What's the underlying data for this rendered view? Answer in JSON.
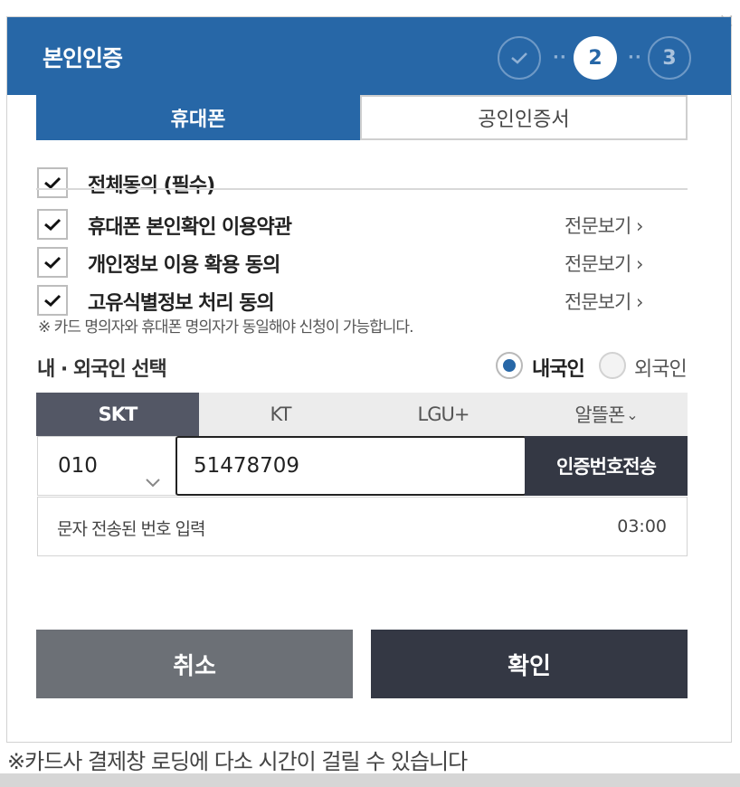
{
  "header": {
    "title": "본인인증",
    "steps": [
      {
        "label": "",
        "state": "done",
        "icon": "check-icon"
      },
      {
        "label": "2",
        "state": "active"
      },
      {
        "label": "3",
        "state": "pending"
      }
    ],
    "step_separator": "··"
  },
  "tabs": [
    {
      "label": "휴대폰",
      "active": true
    },
    {
      "label": "공인인증서",
      "active": false
    }
  ],
  "agreements": {
    "all": {
      "label": "전체동의 (필수)",
      "checked": true
    },
    "items": [
      {
        "label": "휴대폰 본인확인 이용약관",
        "checked": true,
        "link": "전문보기"
      },
      {
        "label": "개인정보 이용 확용 동의",
        "checked": true,
        "link": "전문보기"
      },
      {
        "label": "고유식별정보 처리 동의",
        "checked": true,
        "link": "전문보기"
      }
    ]
  },
  "notice": "※ 카드 명의자와 휴대폰 명의자가 동일해야 신청이 가능합니다.",
  "nationality": {
    "label": "내 · 외국인 선택",
    "options": [
      {
        "label": "내국인",
        "selected": true
      },
      {
        "label": "외국인",
        "selected": false
      }
    ]
  },
  "carriers": [
    {
      "label": "SKT",
      "selected": true
    },
    {
      "label": "KT",
      "selected": false
    },
    {
      "label": "LGU+",
      "selected": false
    },
    {
      "label": "알뜰폰",
      "selected": false,
      "icon": "chevron-down-icon"
    }
  ],
  "phone": {
    "prefix": "010",
    "number": "51478709",
    "send_label": "인증번호전송"
  },
  "code": {
    "placeholder": "문자 전송된 번호 입력",
    "timer": "03:00"
  },
  "buttons": {
    "cancel": "취소",
    "confirm": "확인"
  },
  "footer_note": "※카드사 결제창 로딩에 다소 시간이 걸릴 수 있습니다",
  "colors": {
    "brand": "#2767a7",
    "dark_button": "#343844",
    "carrier_selected": "#535765",
    "cancel_button": "#6c7076"
  }
}
